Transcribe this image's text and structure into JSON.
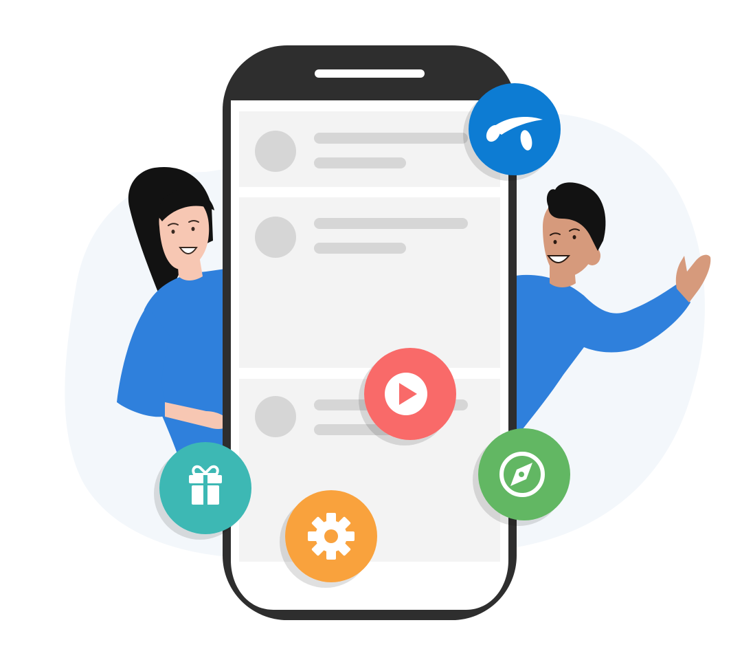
{
  "illustration": {
    "colors": {
      "background_blob": "#F3F7FB",
      "phone_frame": "#2E2E2E",
      "phone_screen": "#FFFFFF",
      "card": "#F3F3F3",
      "placeholder": "#D6D6D6",
      "shirt_blue": "#2F80DC",
      "skin_woman": "#F7C7B3",
      "skin_man": "#D69A7C",
      "hair": "#121212",
      "brand_blue": "#0A7BD3",
      "play_red": "#F96A69",
      "gift_teal": "#3CB8B4",
      "settings_orange": "#F9A23E",
      "compass_green": "#62B763"
    },
    "phone": {
      "cards": [
        {
          "id": "card-1"
        },
        {
          "id": "card-2"
        },
        {
          "id": "card-3"
        }
      ]
    },
    "characters": [
      {
        "id": "woman",
        "pose": "presenting"
      },
      {
        "id": "man",
        "pose": "waving"
      }
    ],
    "feature_badges": [
      {
        "id": "telenor",
        "icon": "telenor-logo-icon"
      },
      {
        "id": "play",
        "icon": "play-icon"
      },
      {
        "id": "gift",
        "icon": "gift-icon"
      },
      {
        "id": "settings",
        "icon": "gear-icon"
      },
      {
        "id": "explore",
        "icon": "compass-icon"
      }
    ]
  }
}
